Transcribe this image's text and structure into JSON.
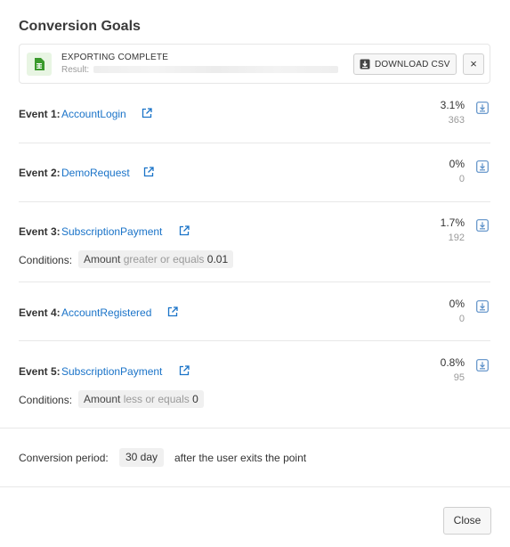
{
  "title": "Conversion Goals",
  "export": {
    "status": "EXPORTING COMPLETE",
    "result_label": "Result:",
    "download_label": "DOWNLOAD CSV",
    "close_symbol": "×"
  },
  "events": [
    {
      "title": "Event 1:",
      "name": "AccountLogin",
      "percent": "3.1%",
      "count": "363"
    },
    {
      "title": "Event 2:",
      "name": "DemoRequest",
      "percent": "0%",
      "count": "0"
    },
    {
      "title": "Event 3:",
      "name": "SubscriptionPayment",
      "percent": "1.7%",
      "count": "192",
      "conditions_label": "Conditions:",
      "condition": {
        "field": "Amount",
        "op": "greater or equals",
        "value": "0.01"
      }
    },
    {
      "title": "Event 4:",
      "name": "AccountRegistered",
      "percent": "0%",
      "count": "0"
    },
    {
      "title": "Event 5:",
      "name": "SubscriptionPayment",
      "percent": "0.8%",
      "count": "95",
      "conditions_label": "Conditions:",
      "condition": {
        "field": "Amount",
        "op": "less or equals",
        "value": "0"
      }
    }
  ],
  "period": {
    "label": "Conversion period:",
    "value": "30 day",
    "suffix": "after the user exits the point"
  },
  "footer": {
    "close_label": "Close"
  },
  "colors": {
    "link": "#1a73c8",
    "icon_blue": "#5b8fc7",
    "csv_green": "#3a9a2c"
  }
}
